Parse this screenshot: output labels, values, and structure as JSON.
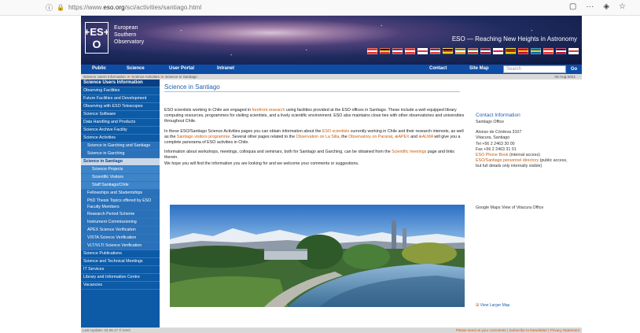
{
  "browser": {
    "info_icon": "info-icon",
    "url_prefix": "https://www.",
    "url_domain": "eso.org",
    "url_path": "/sci/activities/santiago.html"
  },
  "banner": {
    "logo_text": "+ES+O",
    "org_lines": [
      "European",
      "Southern",
      "Observatory"
    ],
    "tagline": "ESO — Reaching New Heights in Astronomy",
    "flag_colors": [
      [
        "#e5322c",
        "#fff",
        "#e5322c"
      ],
      [
        "#111",
        "#f7d417",
        "#e5322c"
      ],
      [
        "#1d4fa0",
        "#fff",
        "#e5322c"
      ],
      [
        "#e5322c",
        "#fff",
        "#e5322c"
      ],
      [
        "#fff",
        "#e5322c",
        "#fff"
      ],
      [
        "#0055a4",
        "#fff",
        "#ef4135"
      ],
      [
        "#111",
        "#e5322c",
        "#f7d417"
      ],
      [
        "#169b62",
        "#fff",
        "#ff883e"
      ],
      [
        "#009246",
        "#fff",
        "#ce2b37"
      ],
      [
        "#21468b",
        "#fff",
        "#ae1c28"
      ],
      [
        "#fff",
        "#dc143c",
        "#fff"
      ],
      [
        "#006600",
        "#ff0000",
        "#ffcc00"
      ],
      [
        "#c60b1e",
        "#ffc400",
        "#c60b1e"
      ],
      [
        "#006aa7",
        "#fecc00",
        "#006aa7"
      ],
      [
        "#e5322c",
        "#fff",
        "#e5322c"
      ],
      [
        "#012169",
        "#fff",
        "#c8102e"
      ],
      [
        "#fff",
        "#e5322c",
        "#fff"
      ]
    ]
  },
  "nav": {
    "items": [
      "Public",
      "Science",
      "User Portal",
      "Intranet",
      "Contact",
      "Site Map"
    ],
    "search_placeholder": "Search",
    "go": "Go"
  },
  "breadcrumb": {
    "parts": [
      "Science Users Information",
      "Science Activities",
      "Science in Santiago"
    ],
    "date": "04-Aug-2021"
  },
  "sidebar": [
    {
      "label": "Science Users Information",
      "kind": "head"
    },
    {
      "label": "Observing Facilities",
      "kind": "l1"
    },
    {
      "label": "Future Facilities and Development",
      "kind": "l1"
    },
    {
      "label": "Observing with ESO Telescopes",
      "kind": "l1"
    },
    {
      "label": "Science Software",
      "kind": "l1"
    },
    {
      "label": "Data Handling and Products",
      "kind": "l1"
    },
    {
      "label": "Science Archive Facility",
      "kind": "l1"
    },
    {
      "label": "Science Activities",
      "kind": "l1"
    },
    {
      "label": "Science in Garching and Santiago",
      "kind": "l2"
    },
    {
      "label": "Science in Garching",
      "kind": "l2"
    },
    {
      "label": "Science in Santiago",
      "kind": "active"
    },
    {
      "label": "Science Projects",
      "kind": "l3"
    },
    {
      "label": "Scientific Visitors",
      "kind": "l3"
    },
    {
      "label": "Staff Santiago/Chile",
      "kind": "l3"
    },
    {
      "label": "Fellowships and Studentships",
      "kind": "l2"
    },
    {
      "label": "PhD Thesis Topics offered by ESO Faculty Members",
      "kind": "l2 two"
    },
    {
      "label": "Research Period Scheme",
      "kind": "l2"
    },
    {
      "label": "Instrument Commissioning",
      "kind": "l2"
    },
    {
      "label": "APEX Science Verification",
      "kind": "l2"
    },
    {
      "label": "VISTA Science Verification",
      "kind": "l2"
    },
    {
      "label": "VLT/VLTI Science Verification",
      "kind": "l2"
    },
    {
      "label": "Science Publications",
      "kind": "l1"
    },
    {
      "label": "Science and Technical Meetings",
      "kind": "l1"
    },
    {
      "label": "IT Services",
      "kind": "l1"
    },
    {
      "label": "Library and Information Centre",
      "kind": "l1"
    },
    {
      "label": "Vacancies",
      "kind": "l1"
    }
  ],
  "main": {
    "title": "Science in Santiago",
    "p1": {
      "before": "ESO scientists working in Chile are engaged in ",
      "link": "forefront research",
      "after": " using facilities provided at the ESO offices in Santiago. These include a well equipped library computing resources, programmes for visiting scientists, and a lively scientific environment. ESO also maintains close ties with other observatories and universities throughout Chile."
    },
    "p2": {
      "t1": "In these ESO/Santiago Science Activities pages you can obtain information about the ",
      "l1": "ESO scientists",
      "t2": " currently working in Chile and their research interests, as well as the ",
      "l2": "Santiago visitors programme",
      "t3": ". Several other pages related to the ",
      "l3": "Observation on La Silla",
      "t4": ", the ",
      "l4": "Observatory on Paranal",
      "t5": ", ",
      "l5": "⊕APEX",
      "t6": " and ",
      "l6": "⊕ALMA",
      "t7": " will give you a complete panorama of ESO activities in Chile."
    },
    "p3": {
      "t1": "Information about workshops, meetings, colloquia and seminars, both for Santiago and Garching, can be obtained from the ",
      "l1": "Scientific meetings",
      "t2": " page and links therein."
    },
    "p4": "We hope you will find the information you are looking for and we welcome your comments or suggestions."
  },
  "contact": {
    "title": "Contact Information",
    "office": "Santiago Office",
    "address1": "Alonso de Córdova 3107",
    "address2": "Vitacura, Santiago",
    "tel": "Tel +56 2 2463 30 00",
    "fax": "Fax +56 2 2463 31 01",
    "phonebook_link": "ESO Phone Book",
    "phonebook_note": "(internal access)",
    "directory_link": "ESO/Santiago personnel directory",
    "directory_note": "(public access, but full details only internally visible)"
  },
  "map": {
    "caption": "Google Maps View of Vitacura Office",
    "larger": "View Larger Map"
  },
  "footer": {
    "left": "Last Update: 02.06.17 © ESO",
    "right": "Please send us your comments | Subscribe to Newsletter | Privacy Statement"
  }
}
